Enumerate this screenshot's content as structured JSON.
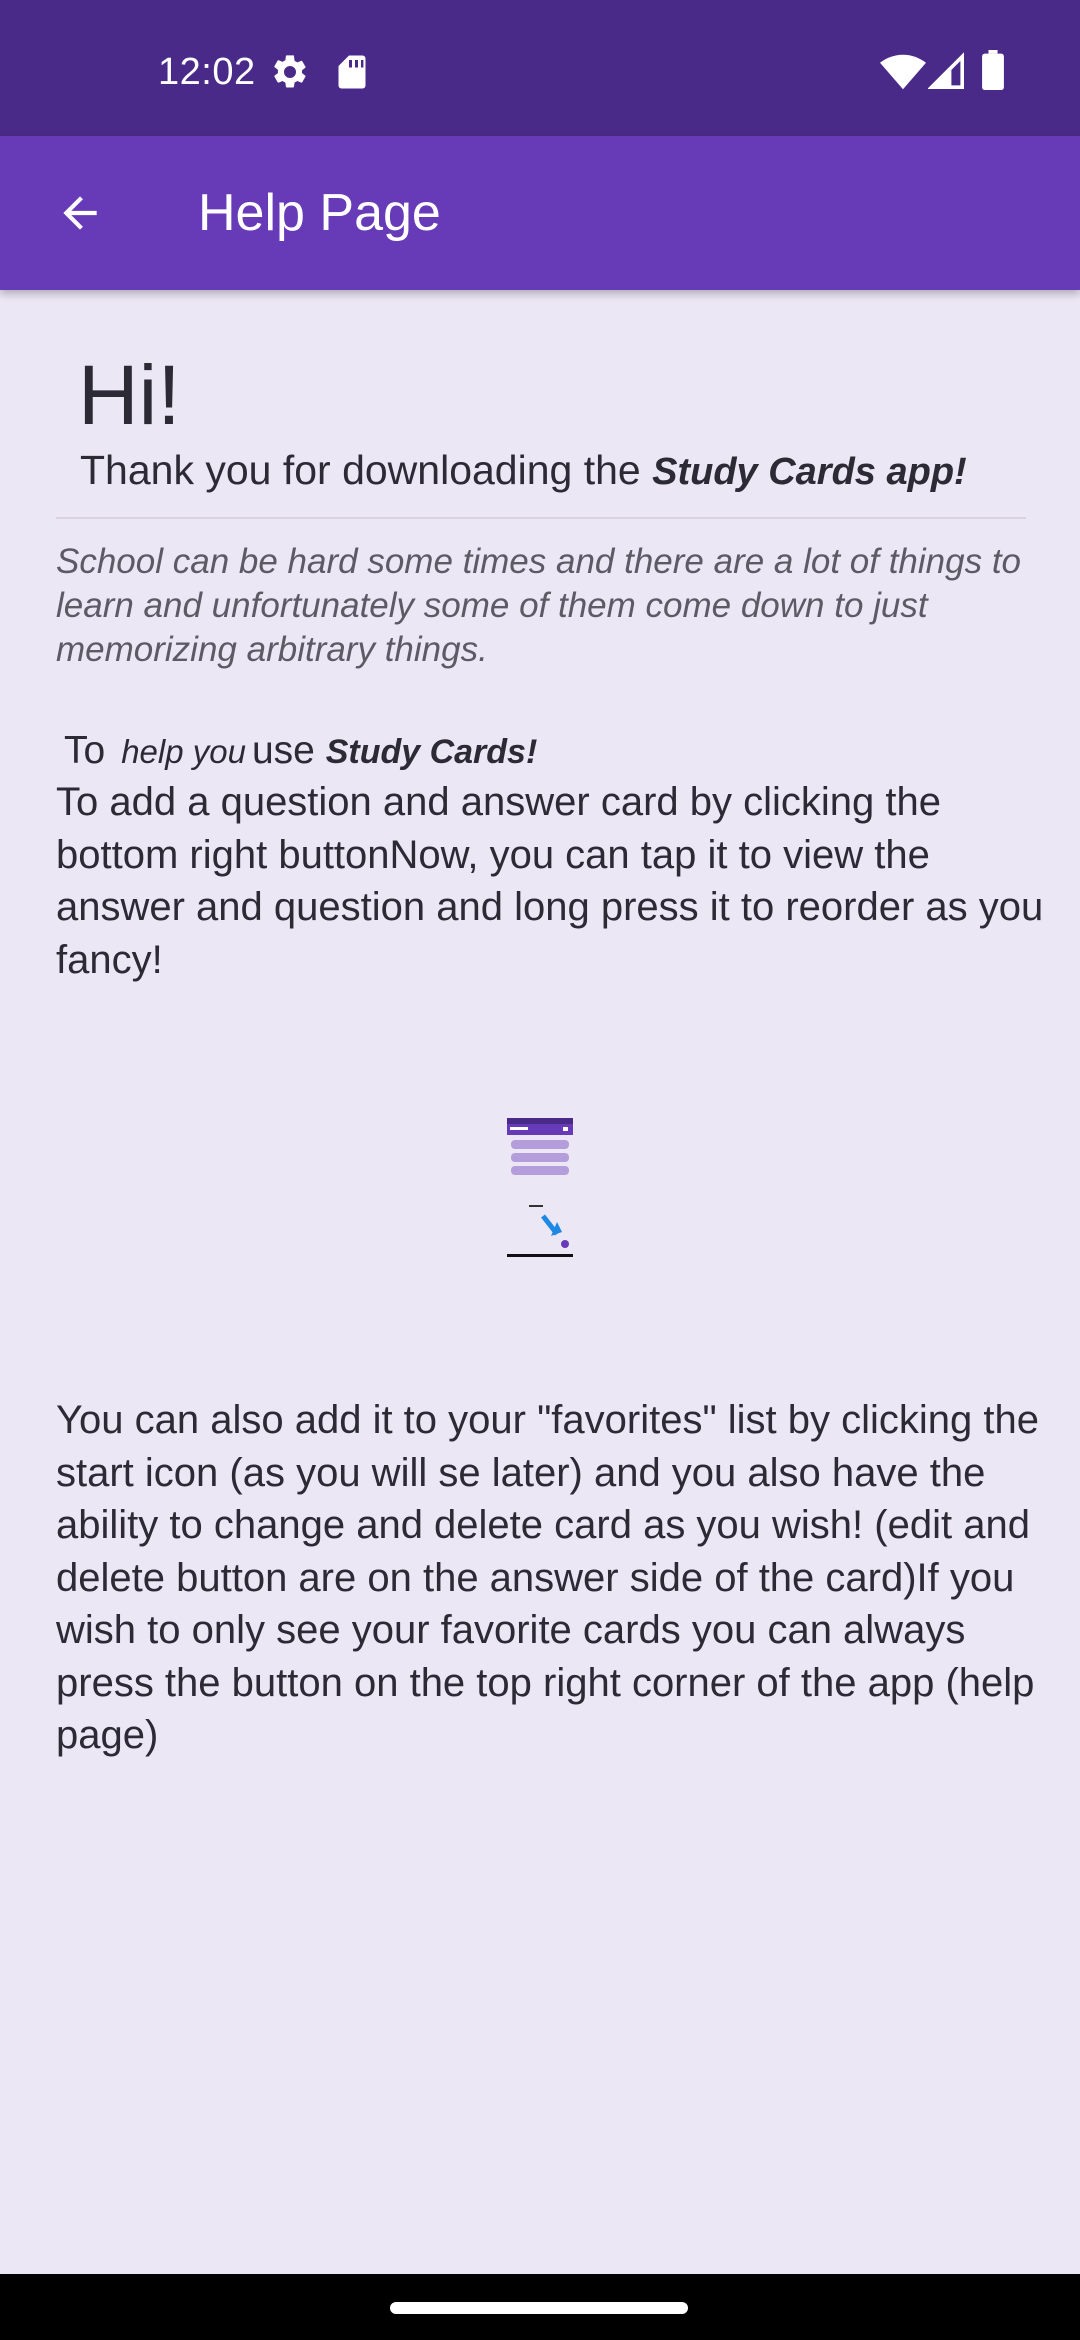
{
  "status_bar": {
    "time": "12:02",
    "icons": [
      "settings-gear-icon",
      "sd-card-icon",
      "wifi-icon",
      "cell-signal-icon",
      "battery-icon"
    ]
  },
  "app_bar": {
    "title": "Help Page",
    "back_icon": "arrow-back-icon",
    "color": "#673AB7"
  },
  "content": {
    "greeting": "Hi!",
    "thanks_prefix": "Thank you for downloading the ",
    "thanks_app": "Study Cards app!",
    "intro": "School can be hard some times and there are a lot of things to learn and unfortunately some of them come down to just memorizing arbitrary things.",
    "help_to": "To",
    "help_you": "help you",
    "help_use": "use",
    "help_app": "Study Cards!",
    "paragraph_1": "To add a question and answer card by clicking the bottom right buttonNow, you can tap it to view the answer and question and long press it to reorder as you fancy!",
    "paragraph_2": "You can also add it to your \"favorites\" list by clicking the start icon (as you will se later) and you also have the ability to change and delete card as you wish! (edit and delete button are on the answer side of the card)If you wish to only see your favorite cards you can always press the button on the top right corner of the app (help page)"
  },
  "colors": {
    "status_bar": "#4A2A88",
    "background": "#ECE7F5",
    "text": "#2B2A35",
    "accent": "#673AB7"
  }
}
